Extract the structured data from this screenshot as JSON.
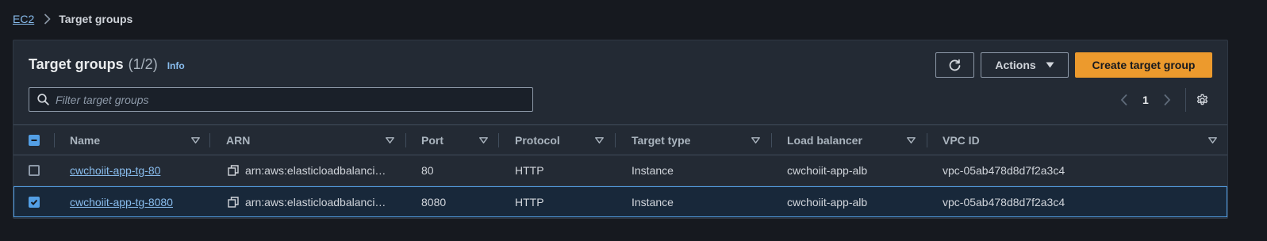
{
  "breadcrumb": {
    "root": "EC2",
    "current": "Target groups"
  },
  "panel": {
    "title": "Target groups",
    "count": "(1/2)",
    "info": "Info",
    "refresh_icon": "refresh-icon",
    "actions_label": "Actions",
    "create_label": "Create target group",
    "search_placeholder": "Filter target groups",
    "page": "1"
  },
  "table": {
    "columns": {
      "name": "Name",
      "arn": "ARN",
      "port": "Port",
      "protocol": "Protocol",
      "target_type": "Target type",
      "load_balancer": "Load balancer",
      "vpc_id": "VPC ID"
    },
    "rows": [
      {
        "selected": false,
        "name": "cwchoiit-app-tg-80",
        "arn": "arn:aws:elasticloadbalanci…",
        "port": "80",
        "protocol": "HTTP",
        "target_type": "Instance",
        "load_balancer": "cwchoiit-app-alb",
        "vpc_id": "vpc-05ab478d8d7f2a3c4"
      },
      {
        "selected": true,
        "name": "cwchoiit-app-tg-8080",
        "arn": "arn:aws:elasticloadbalanci…",
        "port": "8080",
        "protocol": "HTTP",
        "target_type": "Instance",
        "load_balancer": "cwchoiit-app-alb",
        "vpc_id": "vpc-05ab478d8d7f2a3c4"
      }
    ]
  },
  "colors": {
    "accent_link": "#89bdee",
    "primary_button": "#ec9a2d",
    "selection": "#539fe5"
  }
}
